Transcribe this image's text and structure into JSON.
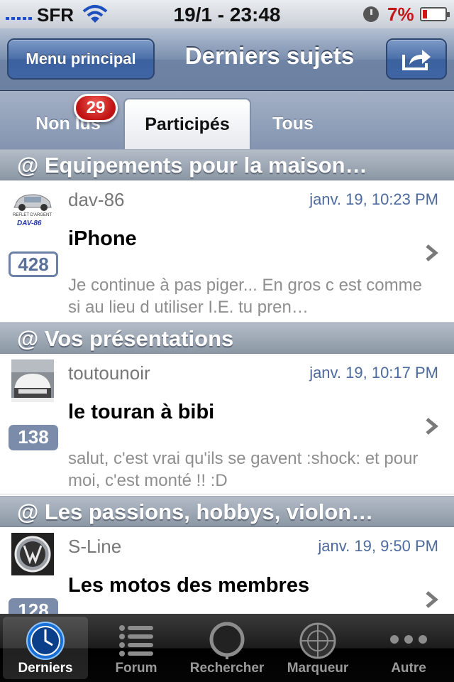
{
  "status_bar": {
    "carrier": "SFR",
    "time": "19/1 - 23:48",
    "battery": "7%"
  },
  "nav": {
    "back_label": "Menu principal",
    "title": "Derniers sujets"
  },
  "tabs": {
    "items": [
      "Non lus",
      "Participés",
      "Tous"
    ],
    "selected": "Participés",
    "unread_badge": "29"
  },
  "sections": [
    {
      "header": "@ Equipements pour la maison…",
      "topic": {
        "author": "dav-86",
        "date": "janv. 19, 10:23 PM",
        "subject": "iPhone",
        "count": "428",
        "excerpt": " Je continue à pas piger... En gros c est comme si au lieu d utiliser I.E. tu pren…",
        "avatar_text_1": "REFLET D'ARGENT",
        "avatar_text_2": "DAV-86"
      }
    },
    {
      "header": "@ Vos présentations",
      "topic": {
        "author": "toutounoir",
        "date": "janv. 19, 10:17 PM",
        "subject": "le touran à bibi",
        "count": "138",
        "excerpt": "salut, c'est vrai qu'ils se gavent  :shock: et pour moi, c'est monté !! :D"
      }
    },
    {
      "header": "@ Les passions, hobbys, violon…",
      "topic": {
        "author": "S-Line",
        "date": "janv. 19, 9:50 PM",
        "subject": "Les motos des membres",
        "count": "128"
      }
    }
  ],
  "tabbar": {
    "items": [
      "Derniers",
      "Forum",
      "Rechercher",
      "Marqueur",
      "Autre"
    ],
    "selected": "Derniers"
  },
  "colors": {
    "nav_blue": "#6c80a2",
    "badge_red": "#c01212",
    "date_blue": "#4c6a9e"
  }
}
